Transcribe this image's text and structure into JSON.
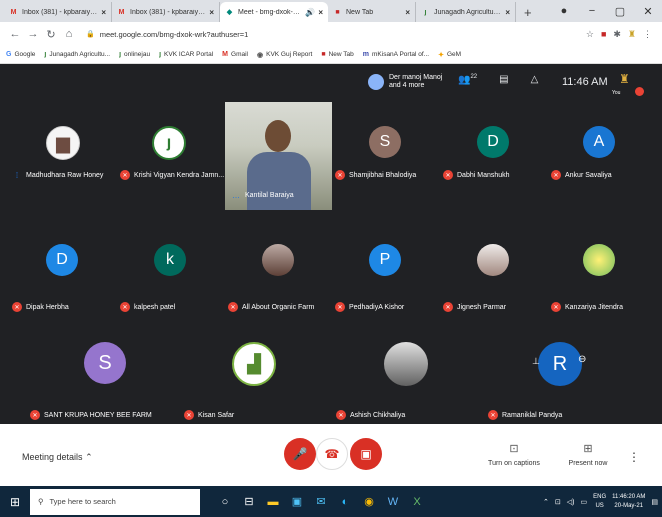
{
  "browser": {
    "tabs": [
      {
        "label": "Inbox (381) - kpbaraiya@gm",
        "icon": "M",
        "icon_color": "#d93025"
      },
      {
        "label": "Inbox (381) - kpbaraiya@gm",
        "icon": "M",
        "icon_color": "#d93025"
      },
      {
        "label": "Meet - bmg-dxok-wrk",
        "icon": "◆",
        "icon_color": "#00897b"
      },
      {
        "label": "New Tab",
        "icon": "■",
        "icon_color": "#c62828"
      },
      {
        "label": "Junagadh Agricultural Unive",
        "icon": "ȷ",
        "icon_color": "#2e7d32"
      }
    ],
    "url": "meet.google.com/bmg-dxok-wrk?authuser=1",
    "bookmarks": [
      {
        "label": "Google",
        "icon": "G",
        "color": "#4285f4"
      },
      {
        "label": "Junagadh Agricultu...",
        "icon": "ȷ",
        "color": "#2e7d32"
      },
      {
        "label": "onlinejau",
        "icon": "ȷ",
        "color": "#2e7d32"
      },
      {
        "label": "KVK ICAR Portal",
        "icon": "ȷ",
        "color": "#2e7d32"
      },
      {
        "label": "Gmail",
        "icon": "M",
        "color": "#d93025"
      },
      {
        "label": "KVK Guj Report",
        "icon": "◉",
        "color": "#555555"
      },
      {
        "label": "New Tab",
        "icon": "■",
        "color": "#c62828"
      },
      {
        "label": "mKisanA Portal of...",
        "icon": "m",
        "color": "#3949ab"
      },
      {
        "label": "GeM",
        "icon": "✦",
        "color": "#f4a300"
      }
    ]
  },
  "meet": {
    "presenter": {
      "line1": "Der manoj Manoj",
      "line2": "and 4 more"
    },
    "participants_badge": "22",
    "time": "11:46 AM",
    "self_label": "You",
    "participants": [
      {
        "name": "Madhudhara Raw Honey",
        "speaking": true,
        "avatar_type": "photo",
        "color": "#6d4c41"
      },
      {
        "name": "Krishi Vigyan Kendra Jamn...",
        "avatar_type": "logo",
        "color": "#2e7d32"
      },
      {
        "name": "Kantilal Baraiya",
        "speaking": true,
        "avatar_type": "video"
      },
      {
        "name": "Shamjibhai Bhalodiya",
        "avatar_type": "letter",
        "letter": "S",
        "color": "#8d6e63"
      },
      {
        "name": "Dabhi Manshukh",
        "avatar_type": "letter",
        "letter": "D",
        "color": "#00796b"
      },
      {
        "name": "Ankur Savaliya",
        "avatar_type": "letter",
        "letter": "A",
        "color": "#1976d2"
      },
      {
        "name": "Dipak Herbha",
        "avatar_type": "letter",
        "letter": "D",
        "color": "#1e88e5"
      },
      {
        "name": "kalpesh patel",
        "avatar_type": "letter",
        "letter": "k",
        "color": "#00695c"
      },
      {
        "name": "All About Organic Farm",
        "avatar_type": "photo",
        "color": "#5d4037"
      },
      {
        "name": "PedhadiyA Kishor",
        "avatar_type": "letter",
        "letter": "P",
        "color": "#1e88e5"
      },
      {
        "name": "Jignesh Parmar",
        "avatar_type": "photo",
        "color": "#a1887f"
      },
      {
        "name": "Kanzariya Jitendra",
        "avatar_type": "photo",
        "color": "#c0ca33"
      },
      {
        "name": "SANT KRUPA HONEY BEE FARM",
        "avatar_type": "letter",
        "letter": "S",
        "color": "#9575cd"
      },
      {
        "name": "Kisan Safar",
        "avatar_type": "logo",
        "color": "#7cb342"
      },
      {
        "name": "Ashish Chikhaliya",
        "avatar_type": "photo",
        "color": "#616161"
      },
      {
        "name": "Ramaniklal Pandya",
        "avatar_type": "letter",
        "letter": "R",
        "color": "#1565c0"
      }
    ]
  },
  "controls": {
    "meeting_details": "Meeting details",
    "turn_on_captions": "Turn on captions",
    "present_now": "Present now"
  },
  "taskbar": {
    "search_placeholder": "Type here to search",
    "lang_top": "ENG",
    "lang_bottom": "US",
    "time": "11:46:20 AM",
    "date": "20-May-21"
  }
}
